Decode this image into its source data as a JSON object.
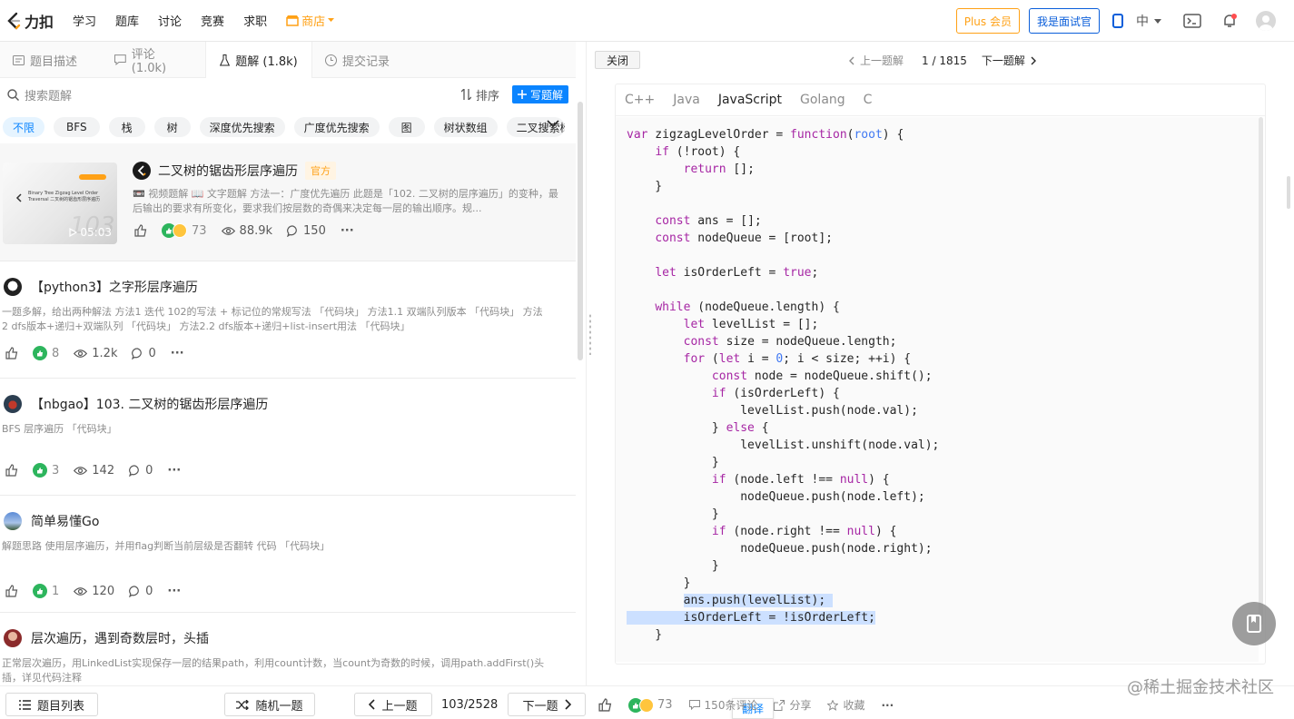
{
  "nav": {
    "logo_text": "力扣",
    "items": [
      "学习",
      "题库",
      "讨论",
      "竞赛",
      "求职"
    ],
    "shop_label": "商店",
    "plus_label": "Plus 会员",
    "interviewer_label": "我是面试官",
    "lang_label": "中"
  },
  "tabs": [
    {
      "label": "题目描述"
    },
    {
      "label": "评论 (1.0k)"
    },
    {
      "label": "题解 (1.8k)"
    },
    {
      "label": "提交记录"
    }
  ],
  "search": {
    "placeholder": "搜索题解",
    "sort_label": "排序",
    "write_label": "写题解"
  },
  "tags": [
    "不限",
    "BFS",
    "栈",
    "树",
    "深度优先搜索",
    "广度优先搜索",
    "图",
    "树状数组",
    "二叉搜索树"
  ],
  "featured": {
    "title": "二叉树的锯齿形层序遍历",
    "badge": "官方",
    "summary": "📼 视频题解 📖 文字题解 方法一：广度优先遍历 此题是「102. 二叉树的层序遍历」的变种，最后输出的要求有所变化，要求我们按层数的奇偶来决定每一层的输出顺序。规...",
    "thumb_title": "Binary Tree Zigzag Level Order Traversal 二叉树的锯齿形层序遍历",
    "thumb_big": "103",
    "duration": "05:03",
    "reactions": "73",
    "views": "88.9k",
    "comments": "150"
  },
  "posts": [
    {
      "title": "【python3】之字形层序遍历",
      "summary": "一题多解，给出两种解法 方法1 迭代 102的写法 + 标记位的常规写法 「代码块」 方法1.1 双端队列版本 「代码块」 方法2 dfs版本+递归+双端队列 「代码块」 方法2.2 dfs版本+递归+list-insert用法 「代码块」",
      "reactions": "8",
      "views": "1.2k",
      "comments": "0"
    },
    {
      "title": "【nbgao】103. 二叉树的锯齿形层序遍历",
      "summary": "BFS 层序遍历 「代码块」",
      "reactions": "3",
      "views": "142",
      "comments": "0"
    },
    {
      "title": "简单易懂Go",
      "summary": "解题思路 使用层序遍历，并用flag判断当前层级是否翻转 代码 「代码块」",
      "reactions": "1",
      "views": "120",
      "comments": "0"
    },
    {
      "title": "层次遍历，遇到奇数层时，头插",
      "summary": "正常层次遍历，用LinkedList实现保存一层的结果path，利用count计数，当count为奇数的时候，调用path.addFirst()头插，详见代码注释",
      "reactions": "",
      "views": "",
      "comments": ""
    }
  ],
  "right": {
    "close_label": "关闭",
    "prev_label": "上一题解",
    "counter": "1 / 1815",
    "next_label": "下一题解",
    "languages": [
      "C++",
      "Java",
      "JavaScript",
      "Golang",
      "C"
    ],
    "active_language": "JavaScript",
    "translate_label": "翻译"
  },
  "bottom": {
    "list_label": "题目列表",
    "random_label": "随机一题",
    "prev_label": "上一题",
    "page": "103/2528",
    "next_label": "下一题",
    "reactions": "73",
    "comments_label": "150条评论",
    "share_label": "分享",
    "fav_label": "收藏"
  },
  "watermark": "@稀土掘金技术社区",
  "colors": {
    "brand_orange": "#ffa116",
    "link_blue": "#0a84ff",
    "selection": "#cce0ff",
    "keyword": "#a626a4"
  }
}
